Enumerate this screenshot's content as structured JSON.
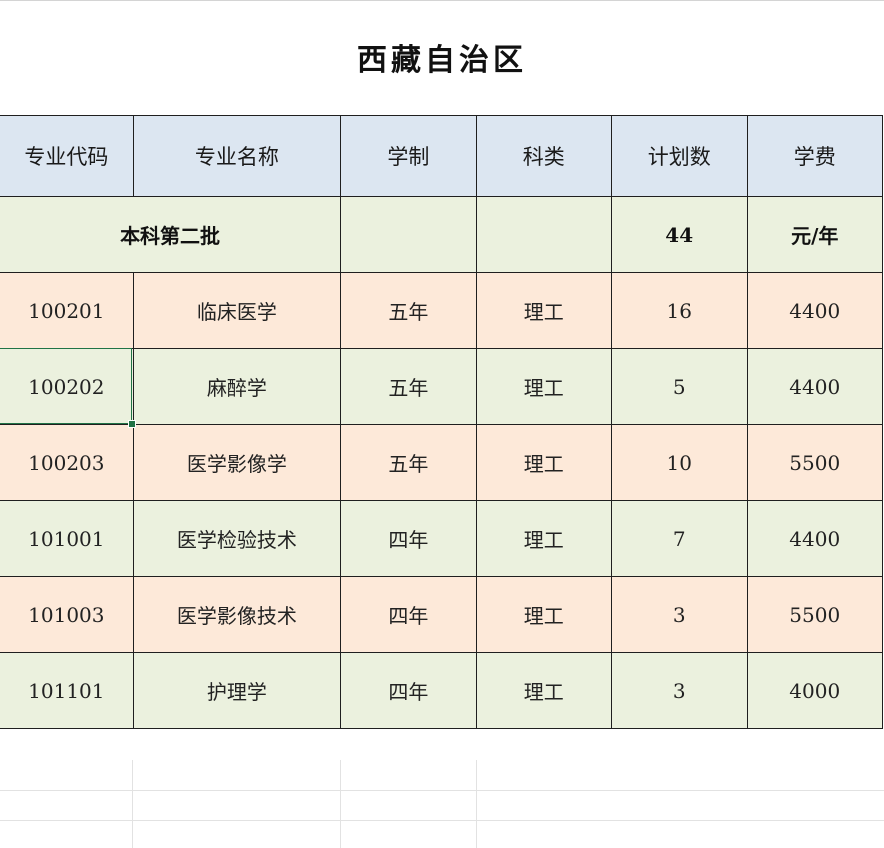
{
  "sheet": {
    "title": "西藏自治区",
    "headers": [
      "专业代码",
      "专业名称",
      "学制",
      "科类",
      "计划数",
      "学费"
    ],
    "batch": {
      "label": "本科第二批",
      "plan_total": "44",
      "fee_unit": "元/年"
    },
    "rows": [
      {
        "code": "100201",
        "name": "临床医学",
        "duration": "五年",
        "category": "理工",
        "plan": "16",
        "fee": "4400"
      },
      {
        "code": "100202",
        "name": "麻醉学",
        "duration": "五年",
        "category": "理工",
        "plan": "5",
        "fee": "4400"
      },
      {
        "code": "100203",
        "name": "医学影像学",
        "duration": "五年",
        "category": "理工",
        "plan": "10",
        "fee": "5500"
      },
      {
        "code": "101001",
        "name": "医学检验技术",
        "duration": "四年",
        "category": "理工",
        "plan": "7",
        "fee": "4400"
      },
      {
        "code": "101003",
        "name": "医学影像技术",
        "duration": "四年",
        "category": "理工",
        "plan": "3",
        "fee": "5500"
      },
      {
        "code": "101101",
        "name": "护理学",
        "duration": "四年",
        "category": "理工",
        "plan": "3",
        "fee": "4000"
      }
    ]
  },
  "colors": {
    "header_bg": "#dce6f1",
    "green_row_bg": "#ebf1de",
    "peach_row_bg": "#fde9d9",
    "selection_border": "#217346"
  }
}
